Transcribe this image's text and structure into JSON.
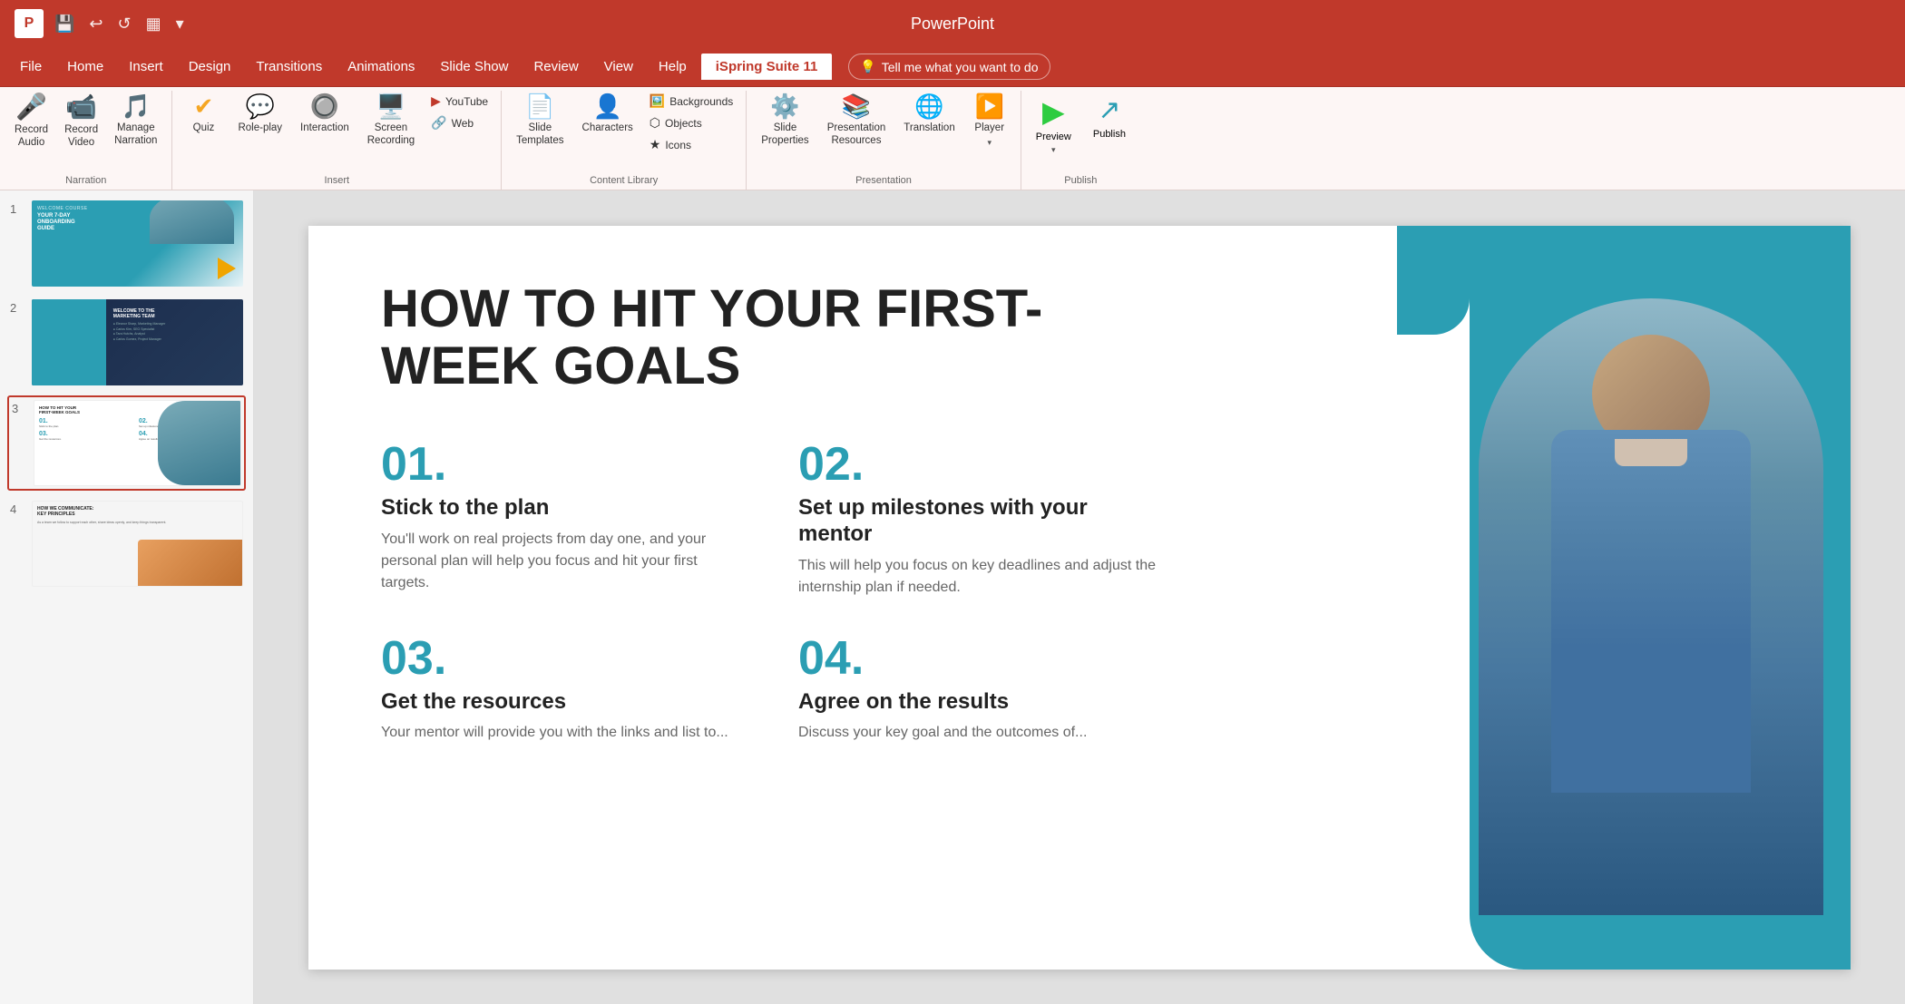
{
  "titlebar": {
    "title": "PowerPoint",
    "icon": "P"
  },
  "menubar": {
    "items": [
      {
        "label": "File",
        "active": false
      },
      {
        "label": "Home",
        "active": false
      },
      {
        "label": "Insert",
        "active": false
      },
      {
        "label": "Design",
        "active": false
      },
      {
        "label": "Transitions",
        "active": false
      },
      {
        "label": "Animations",
        "active": false
      },
      {
        "label": "Slide Show",
        "active": false
      },
      {
        "label": "Review",
        "active": false
      },
      {
        "label": "View",
        "active": false
      },
      {
        "label": "Help",
        "active": false
      },
      {
        "label": "iSpring Suite 11",
        "active": true
      }
    ],
    "tell_me": "Tell me what you want to do"
  },
  "ribbon": {
    "groups": [
      {
        "name": "Narration",
        "label": "Narration",
        "items": [
          {
            "id": "record-audio",
            "icon": "🎤",
            "label": "Record\nAudio"
          },
          {
            "id": "record-video",
            "icon": "📹",
            "label": "Record\nVideo"
          },
          {
            "id": "manage-narration",
            "icon": "🎵",
            "label": "Manage\nNarration"
          }
        ]
      },
      {
        "name": "Insert",
        "label": "Insert",
        "items": [
          {
            "id": "quiz",
            "icon": "✅",
            "label": "Quiz"
          },
          {
            "id": "role-play",
            "icon": "💬",
            "label": "Role-play"
          },
          {
            "id": "interaction",
            "icon": "🖱️",
            "label": "Interaction"
          },
          {
            "id": "screen-recording",
            "icon": "🖥️",
            "label": "Screen\nRecording"
          },
          {
            "id": "youtube",
            "icon": "▶",
            "label": "YouTube",
            "small": true,
            "color": "#c0392b"
          },
          {
            "id": "web",
            "icon": "🔗",
            "label": "Web",
            "small": true
          }
        ]
      },
      {
        "name": "ContentLibrary",
        "label": "Content Library",
        "items": [
          {
            "id": "slide-templates",
            "icon": "📄",
            "label": "Slide\nTemplates"
          },
          {
            "id": "characters",
            "icon": "👤",
            "label": "Characters"
          },
          {
            "id": "backgrounds",
            "icon": "🖼️",
            "label": "Backgrounds",
            "small": true
          },
          {
            "id": "objects",
            "icon": "⬡",
            "label": "Objects",
            "small": true
          },
          {
            "id": "icons",
            "icon": "★",
            "label": "Icons",
            "small": true
          }
        ]
      },
      {
        "name": "Presentation",
        "label": "Presentation",
        "items": [
          {
            "id": "slide-properties",
            "icon": "🔧",
            "label": "Slide\nProperties"
          },
          {
            "id": "presentation-resources",
            "icon": "📚",
            "label": "Presentation\nResources"
          },
          {
            "id": "translation",
            "icon": "🌐",
            "label": "Translation"
          },
          {
            "id": "player",
            "icon": "▶",
            "label": "Player"
          }
        ]
      },
      {
        "name": "Publish",
        "label": "Publish",
        "items": [
          {
            "id": "preview",
            "icon": "▶",
            "label": "Preview"
          },
          {
            "id": "publish",
            "icon": "↗",
            "label": "Publish"
          }
        ]
      }
    ]
  },
  "slides": [
    {
      "num": "1",
      "title": "YOUR 7-DAY ONBOARDING GUIDE",
      "subtitle": "WELCOME COURSE"
    },
    {
      "num": "2",
      "title": "WELCOME TO THE MARKETING TEAM"
    },
    {
      "num": "3",
      "title": "HOW TO HIT YOUR FIRST-WEEK GOALS",
      "active": true
    },
    {
      "num": "4",
      "title": "HOW WE COMMUNICATE: KEY PRINCIPLES"
    }
  ],
  "slide_content": {
    "title": "HOW TO HIT YOUR FIRST-WEEK GOALS",
    "items": [
      {
        "num": "01.",
        "title": "Stick to the plan",
        "desc": "You'll work on real projects from day one, and your personal plan will help you focus and hit your first targets."
      },
      {
        "num": "02.",
        "title": "Set up milestones with your mentor",
        "desc": "This will help you focus on key deadlines and adjust the internship plan if needed."
      },
      {
        "num": "03.",
        "title": "Get the resources",
        "desc": "Your mentor will provide you with the links and list to..."
      },
      {
        "num": "04.",
        "title": "Agree on the results",
        "desc": "Discuss your key goal and the outcomes of..."
      }
    ]
  }
}
